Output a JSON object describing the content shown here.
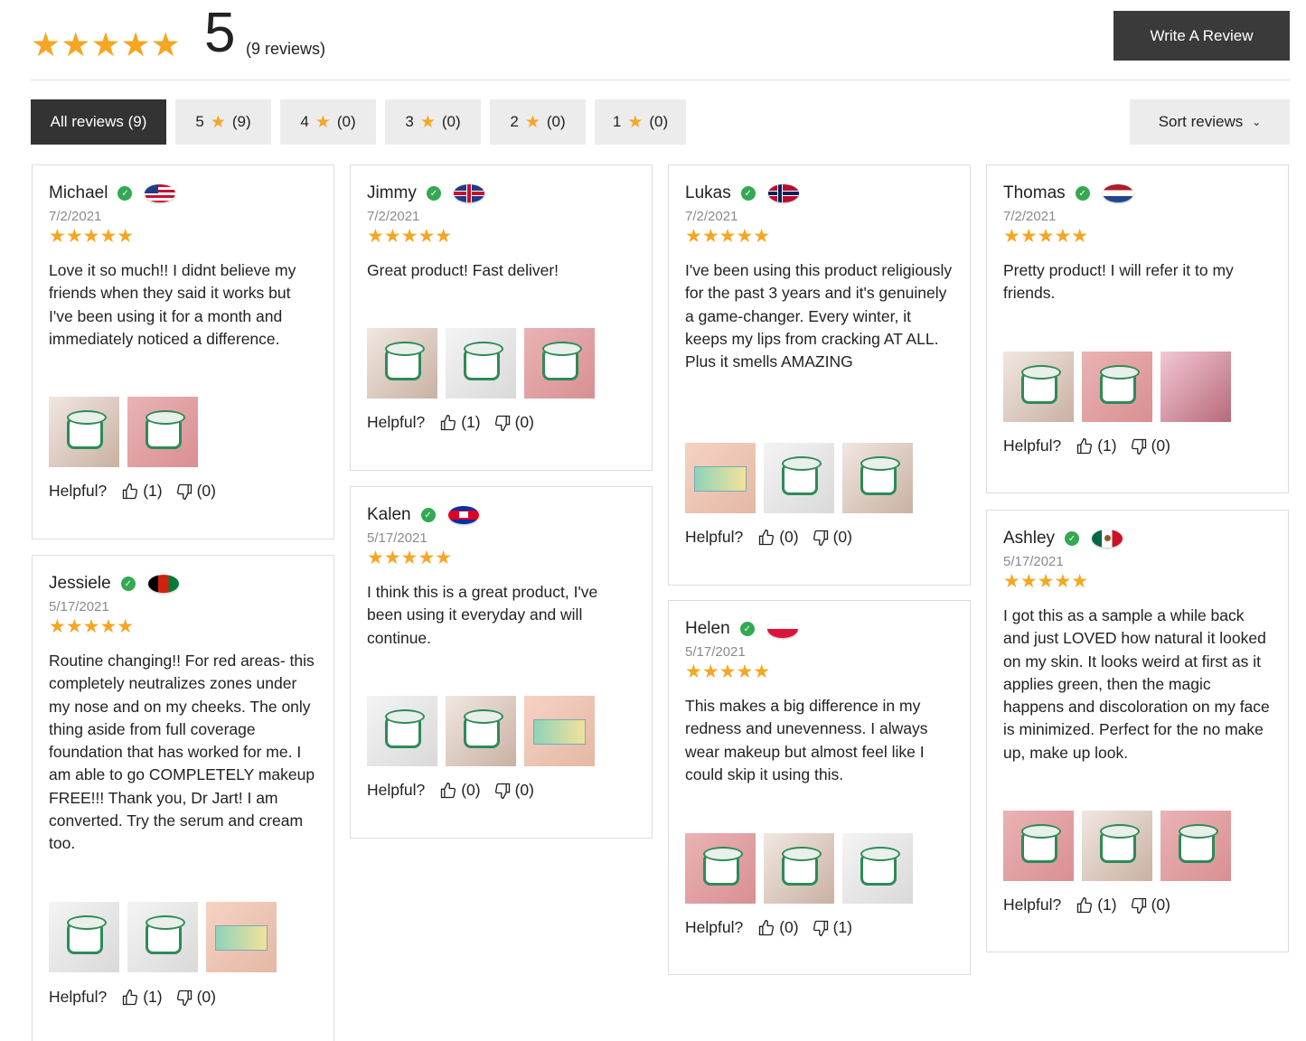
{
  "summary": {
    "stars": "★★★★★",
    "average": "5",
    "count_text": "(9 reviews)",
    "write_review_label": "Write A Review"
  },
  "filters": [
    {
      "label": "All reviews (9)",
      "active": true
    },
    {
      "label": "5",
      "count": "(9)"
    },
    {
      "label": "4",
      "count": "(0)"
    },
    {
      "label": "3",
      "count": "(0)"
    },
    {
      "label": "2",
      "count": "(0)"
    },
    {
      "label": "1",
      "count": "(0)"
    }
  ],
  "sort_label": "Sort reviews",
  "helpful_label": "Helpful?",
  "colors": {
    "star": "#f5a623",
    "verified": "#34a853",
    "dark_button": "#3a3a3a"
  },
  "reviews": [
    {
      "name": "Michael",
      "flag": "us-flag",
      "date": "7/2/2021",
      "stars": "★★★★★",
      "text": "Love it so much!! I didnt believe my friends when they said it works but I've been using it for a month and immediately noticed a difference.",
      "up": "(1)",
      "down": "(0)"
    },
    {
      "name": "Jessiele",
      "flag": "afghanistan-flag",
      "date": "5/17/2021",
      "stars": "★★★★★",
      "text": "Routine changing!! For red areas- this completely neutralizes zones under my nose and on my cheeks. The only thing aside from full coverage foundation that has worked for me. I am able to go COMPLETELY makeup FREE!!! Thank you, Dr Jart! I am converted. Try the serum and cream too.",
      "up": "(1)",
      "down": "(0)"
    },
    {
      "name": "Jimmy",
      "flag": "uk-flag",
      "date": "7/2/2021",
      "stars": "★★★★★",
      "text": "Great product! Fast deliver!",
      "up": "(1)",
      "down": "(0)"
    },
    {
      "name": "Kalen",
      "flag": "cambodia-flag",
      "date": "5/17/2021",
      "stars": "★★★★★",
      "text": "I think this is a great product, I've been using it everyday and will continue.",
      "up": "(0)",
      "down": "(0)"
    },
    {
      "name": "Lukas",
      "flag": "norway-flag",
      "date": "7/2/2021",
      "stars": "★★★★★",
      "text": "I've been using this product religiously for the past 3 years and it's genuinely a game-changer. Every winter, it keeps my lips from cracking AT ALL. Plus it smells AMAZING",
      "up": "(0)",
      "down": "(0)"
    },
    {
      "name": "Helen",
      "flag": "poland-flag",
      "date": "5/17/2021",
      "stars": "★★★★★",
      "text": "This makes a big difference in my redness and unevenness. I always wear makeup but almost feel like I could skip it using this.",
      "up": "(0)",
      "down": "(1)"
    },
    {
      "name": "Thomas",
      "flag": "netherlands-flag",
      "date": "7/2/2021",
      "stars": "★★★★★",
      "text": "Pretty product! I will refer it to my friends.",
      "up": "(1)",
      "down": "(0)"
    },
    {
      "name": "Ashley",
      "flag": "mexico-flag",
      "date": "5/17/2021",
      "stars": "★★★★★",
      "text": "I got this as a sample a while back and just LOVED how natural it looked on my skin. It looks weird at first as it applies green, then the magic happens and discoloration on my face is minimized. Perfect for the no make up, make up look.",
      "up": "(1)",
      "down": "(0)"
    }
  ]
}
